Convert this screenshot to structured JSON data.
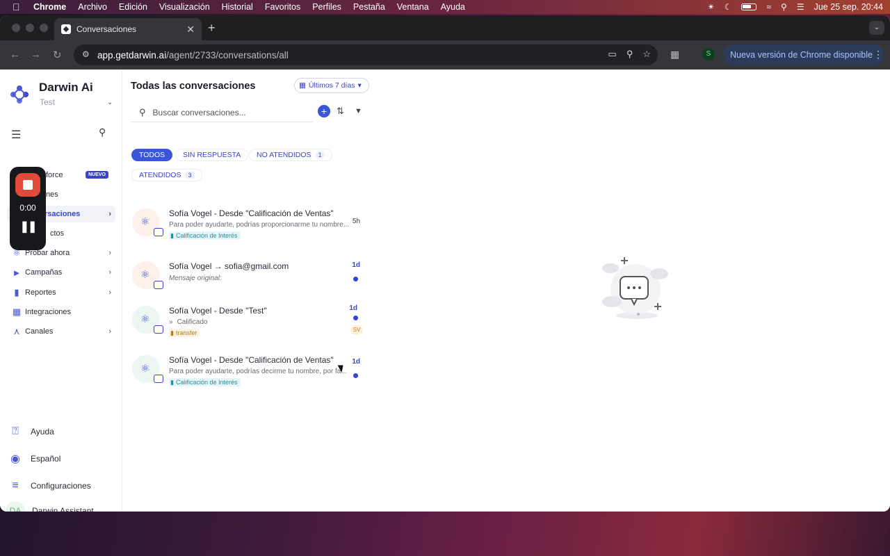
{
  "menubar": {
    "app": "Chrome",
    "items": [
      "Archivo",
      "Edición",
      "Visualización",
      "Historial",
      "Favoritos",
      "Perfiles",
      "Pestaña",
      "Ventana",
      "Ayuda"
    ],
    "clock": "Jue 25 sep.  20:44"
  },
  "browser": {
    "tab_title": "Conversaciones",
    "url_host": "app.getdarwin.ai",
    "url_path": "/agent/2733/conversations/all",
    "profile_initial": "S",
    "update_label": "Nueva versión de Chrome disponible"
  },
  "sidebar": {
    "brand": "Darwin Ai",
    "workspace": "Test",
    "items": [
      {
        "label": "force",
        "badge": "NUEVO"
      },
      {
        "label": "nes"
      },
      {
        "label": "rsaciones"
      },
      {
        "label": "ctos"
      },
      {
        "label": "Probar ahora"
      },
      {
        "label": "Campañas"
      },
      {
        "label": "Reportes"
      },
      {
        "label": "Integraciones"
      },
      {
        "label": "Canales"
      }
    ],
    "bottom": {
      "help": "Ayuda",
      "language": "Español",
      "settings": "Configuraciones",
      "assistant_initials": "DA",
      "assistant": "Darwin Assistant"
    }
  },
  "recorder": {
    "time": "0:00"
  },
  "conversations": {
    "title": "Todas las conversaciones",
    "date_filter": "Últimos 7 días",
    "search_placeholder": "Buscar conversaciones...",
    "filters": [
      {
        "label": "TODOS"
      },
      {
        "label": "SIN RESPUESTA"
      },
      {
        "label": "NO ATENDIDOS",
        "count": "1"
      },
      {
        "label": "ATENDIDOS",
        "count": "3"
      }
    ],
    "items": [
      {
        "name": "Sofía Vogel - Desde \"Calificación de Ventas\"",
        "snippet": "Para poder ayudarte, podrías proporcionarme tu nombre...",
        "tag": "Calificación de Interés",
        "time": "5h"
      },
      {
        "name": "Sofía Vogel → sofia@gmail.com",
        "snippet": "Mensaje original:",
        "time": "1d"
      },
      {
        "name": "Sofía Vogel - Desde \"Test\"",
        "snippet": "Calificado",
        "tag": "transfer",
        "time": "1d",
        "assignee": "SV"
      },
      {
        "name": "Sofía Vogel - Desde \"Calificación de Ventas\"",
        "snippet": "Para poder ayudarte, podrías decirme tu nombre, por fa...",
        "tag": "Calificación de Interés",
        "time": "1d"
      }
    ]
  },
  "colors": {
    "accent": "#3a55d9",
    "record": "#e04a3a"
  }
}
